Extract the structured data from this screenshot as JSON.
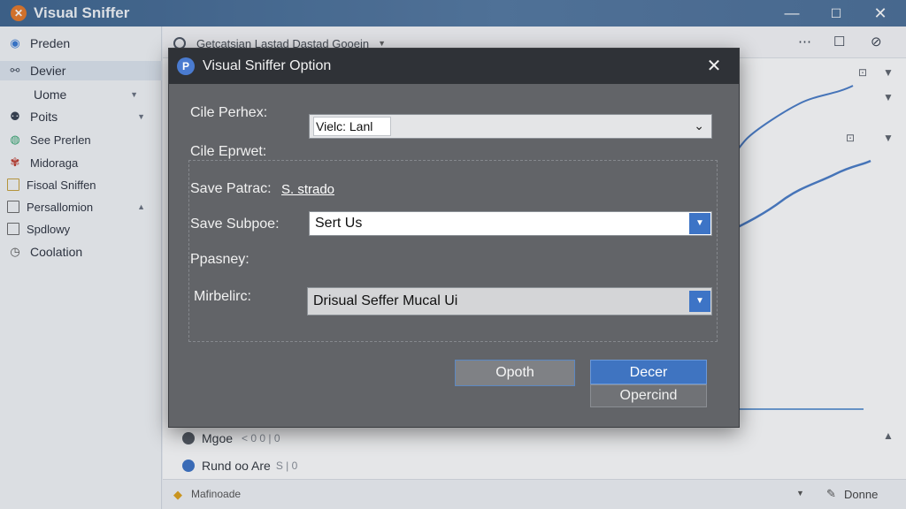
{
  "app": {
    "title": "Visual Sniffer",
    "window_controls": {
      "minimize": "—",
      "maximize": "☐",
      "close": "✕"
    }
  },
  "sidebar": {
    "items": [
      {
        "label": "Preden",
        "icon": "globe-icon"
      },
      {
        "label": "Devier",
        "icon": "link-icon"
      },
      {
        "label": "Uome",
        "icon": ""
      },
      {
        "label": "Poits",
        "icon": "people-icon"
      },
      {
        "label": "See Prerlen",
        "icon": "chrome-icon"
      },
      {
        "label": "Midoraga",
        "icon": "palette-icon"
      },
      {
        "label": "Fisoal Sniffen",
        "icon": "box-icon"
      },
      {
        "label": "Persallomion",
        "icon": "box-icon"
      },
      {
        "label": "Spdlowy",
        "icon": "box-icon"
      },
      {
        "label": "Coolation",
        "icon": "clock-icon"
      }
    ]
  },
  "main": {
    "search_text": "Getcatsian Lastad Dastad Gooein",
    "bottom_rows": [
      {
        "label": "Mgoe",
        "suffix": "< 0 0 | 0"
      },
      {
        "label": "Rund oo Are",
        "suffix": "S | 0"
      }
    ],
    "status_left": "Mafinoade",
    "status_right": "Donne"
  },
  "dialog": {
    "title": "Visual Sniffer Option",
    "icon_letter": "P",
    "fields": {
      "cile_perhex_label": "Cile Perhex:",
      "cile_perhex_value": "Vielc: Lanl",
      "cile_eprwet_label": "Cile Eprwet:",
      "save_patrac_label": "Save Patrac:",
      "save_patrac_link": "S. strado",
      "save_subpoe_label": "Save Subpoe:",
      "save_subpoe_value": "Sert Us",
      "ppasney_label": "Ppasney:",
      "mirbelirc_label": "Mirbelirc:",
      "mirbelirc_value": "Drisual Seffer Mucal Ui"
    },
    "buttons": {
      "secondary": "Opoth",
      "primary": "Decer",
      "tertiary": "Opercind"
    }
  },
  "colors": {
    "accent": "#3f74c1",
    "dialog_bg": "#626468",
    "titlebar": "#2f3237",
    "app_titlebar": "#4c7099",
    "chart_line": "#4a7ec9"
  }
}
